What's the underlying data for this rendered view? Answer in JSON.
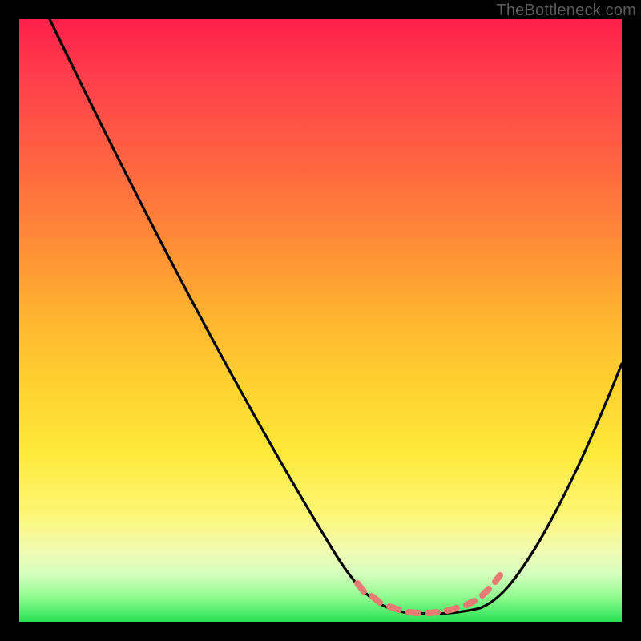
{
  "watermark": "TheBottleneck.com",
  "colors": {
    "gradient_top": "#ff1f4a",
    "gradient_bottom": "#27e152",
    "curve": "#000000",
    "markers": "#e87a74",
    "frame": "#000000"
  },
  "chart_data": {
    "type": "line",
    "title": "",
    "xlabel": "",
    "ylabel": "",
    "xlim": [
      0,
      100
    ],
    "ylim": [
      0,
      100
    ],
    "x": [
      0,
      5,
      10,
      15,
      20,
      25,
      30,
      35,
      40,
      45,
      50,
      55,
      57,
      60,
      63,
      65,
      68,
      70,
      72,
      74,
      76,
      78,
      80,
      85,
      90,
      95,
      100
    ],
    "values": [
      100,
      92,
      84,
      76,
      68,
      60,
      52,
      44,
      36,
      28,
      20,
      12,
      8,
      4,
      2,
      1,
      0.5,
      0.5,
      0.5,
      0.5,
      1,
      2,
      5,
      13,
      23,
      35,
      48
    ],
    "markers": {
      "x": [
        57,
        60,
        63,
        65,
        67,
        69,
        71,
        73,
        75,
        77,
        79
      ],
      "y": [
        6,
        4,
        2.5,
        1.5,
        1,
        1,
        1,
        1,
        1.5,
        3,
        5
      ]
    },
    "notes": "y = bottleneck percentage (lower is better, green zone near bottom); x = relative component balance; curve shows a V-shaped bottleneck valley with minimum around x≈70."
  }
}
